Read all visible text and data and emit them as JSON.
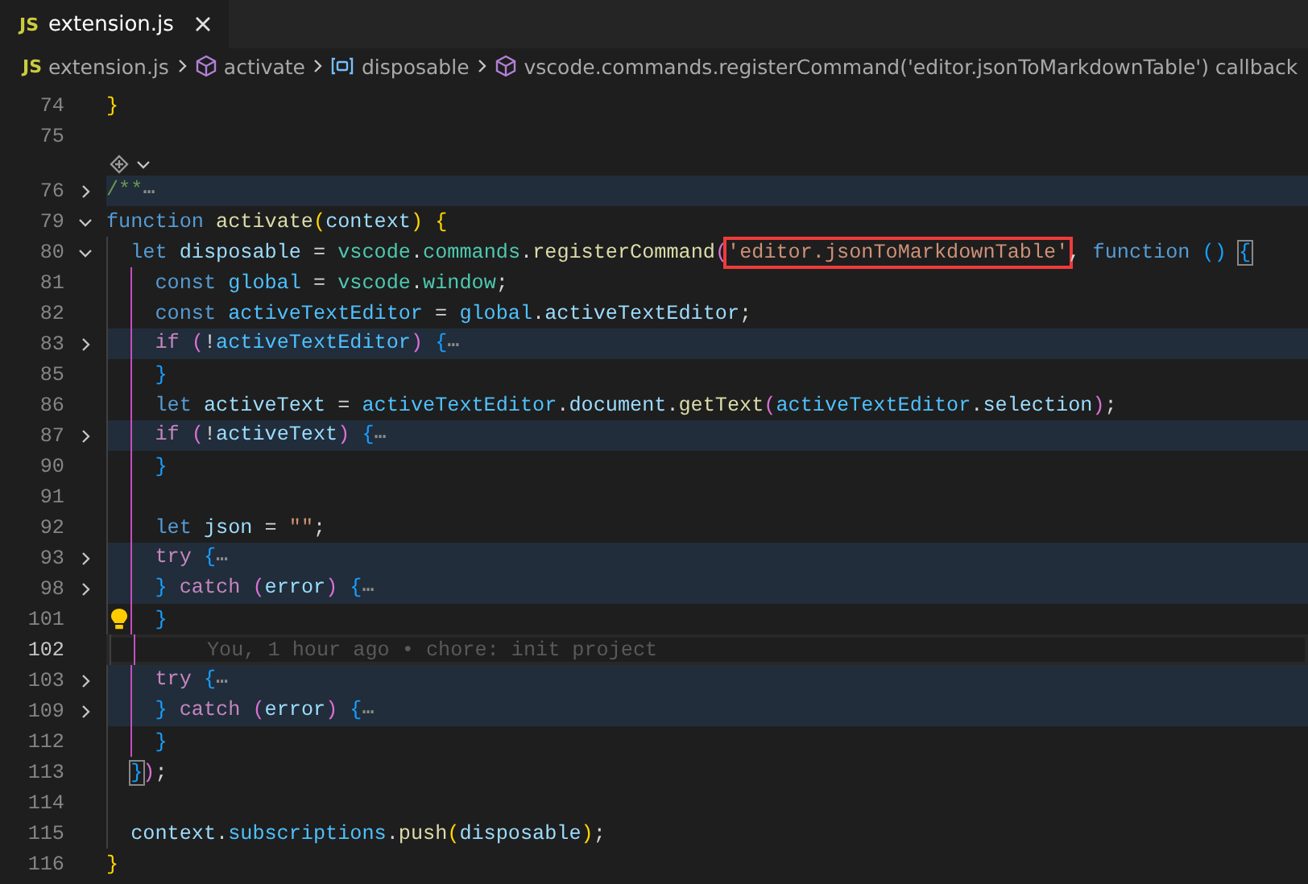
{
  "tab": {
    "icon_label": "JS",
    "title": "extension.js",
    "selected": true
  },
  "breadcrumbs": [
    {
      "kind": "file",
      "icon_label": "JS",
      "label": "extension.js"
    },
    {
      "kind": "method",
      "label": "activate"
    },
    {
      "kind": "variable",
      "label": "disposable"
    },
    {
      "kind": "method",
      "label": "vscode.commands.registerCommand('editor.jsonToMarkdownTable') callback"
    }
  ],
  "lines": [
    {
      "kind": "code",
      "number": "74",
      "tokens": [
        {
          "text": "}",
          "kind": "b1"
        }
      ]
    },
    {
      "kind": "code",
      "number": "75"
    },
    {
      "kind": "codelens"
    },
    {
      "kind": "code",
      "number": "76",
      "folded": true,
      "tokens": [
        {
          "text": "/**",
          "kind": "comment"
        },
        {
          "text": "⋯",
          "kind": "ellipsis"
        }
      ]
    },
    {
      "kind": "code",
      "number": "79",
      "folded": false,
      "tokens": [
        {
          "text": "function",
          "kind": "kw"
        },
        {
          "text": " activate",
          "kind": "fn"
        },
        {
          "text": "(",
          "kind": "b1"
        },
        {
          "text": "context",
          "kind": "var"
        },
        {
          "text": ")",
          "kind": "b1"
        },
        {
          "text": " {",
          "kind": "b1"
        }
      ],
      "children": [
        {
          "kind": "code",
          "number": "80",
          "folded": false,
          "tokens": [
            {
              "text": "let",
              "kind": "kw"
            },
            {
              "text": " disposable",
              "kind": "var"
            },
            {
              "text": " = ",
              "kind": "op"
            },
            {
              "text": "vscode",
              "kind": "cls"
            },
            {
              "text": ".",
              "kind": "op"
            },
            {
              "text": "commands",
              "kind": "cls"
            },
            {
              "text": ".",
              "kind": "op"
            },
            {
              "text": "registerCommand",
              "kind": "fn"
            },
            {
              "text": "(",
              "kind": "b2"
            },
            {
              "text": "'editor.jsonToMarkdownTable'",
              "kind": "str",
              "annotated": true
            },
            {
              "text": ", ",
              "kind": "op"
            },
            {
              "text": "function",
              "kind": "kw"
            },
            {
              "text": " () ",
              "kind": "b3"
            },
            {
              "text": "{",
              "kind": "b3",
              "bracket_match": true
            }
          ],
          "children": [
            {
              "kind": "code",
              "number": "81",
              "tokens": [
                {
                  "text": "const",
                  "kind": "kw"
                },
                {
                  "text": " global",
                  "kind": "const"
                },
                {
                  "text": " = ",
                  "kind": "op"
                },
                {
                  "text": "vscode",
                  "kind": "cls"
                },
                {
                  "text": ".",
                  "kind": "op"
                },
                {
                  "text": "window",
                  "kind": "cls"
                },
                {
                  "text": ";",
                  "kind": "op"
                }
              ]
            },
            {
              "kind": "code",
              "number": "82",
              "tokens": [
                {
                  "text": "const",
                  "kind": "kw"
                },
                {
                  "text": " activeTextEditor",
                  "kind": "const"
                },
                {
                  "text": " = ",
                  "kind": "op"
                },
                {
                  "text": "global",
                  "kind": "const"
                },
                {
                  "text": ".",
                  "kind": "op"
                },
                {
                  "text": "activeTextEditor",
                  "kind": "var"
                },
                {
                  "text": ";",
                  "kind": "op"
                }
              ]
            },
            {
              "kind": "code",
              "number": "83",
              "folded": true,
              "tokens": [
                {
                  "text": "if",
                  "kind": "ctl"
                },
                {
                  "text": " (",
                  "kind": "b2"
                },
                {
                  "text": "!",
                  "kind": "op"
                },
                {
                  "text": "activeTextEditor",
                  "kind": "const"
                },
                {
                  "text": ")",
                  "kind": "b2"
                },
                {
                  "text": " {",
                  "kind": "b3"
                },
                {
                  "text": "⋯",
                  "kind": "ellipsis"
                }
              ]
            },
            {
              "kind": "code",
              "number": "85",
              "tokens": [
                {
                  "text": "}",
                  "kind": "b3"
                }
              ]
            },
            {
              "kind": "code",
              "number": "86",
              "tokens": [
                {
                  "text": "let",
                  "kind": "kw"
                },
                {
                  "text": " activeText",
                  "kind": "var"
                },
                {
                  "text": " = ",
                  "kind": "op"
                },
                {
                  "text": "activeTextEditor",
                  "kind": "const"
                },
                {
                  "text": ".",
                  "kind": "op"
                },
                {
                  "text": "document",
                  "kind": "var"
                },
                {
                  "text": ".",
                  "kind": "op"
                },
                {
                  "text": "getText",
                  "kind": "fn"
                },
                {
                  "text": "(",
                  "kind": "b2"
                },
                {
                  "text": "activeTextEditor",
                  "kind": "const"
                },
                {
                  "text": ".",
                  "kind": "op"
                },
                {
                  "text": "selection",
                  "kind": "var"
                },
                {
                  "text": ")",
                  "kind": "b2"
                },
                {
                  "text": ";",
                  "kind": "op"
                }
              ]
            },
            {
              "kind": "code",
              "number": "87",
              "folded": true,
              "tokens": [
                {
                  "text": "if",
                  "kind": "ctl"
                },
                {
                  "text": " (",
                  "kind": "b2"
                },
                {
                  "text": "!",
                  "kind": "op"
                },
                {
                  "text": "activeText",
                  "kind": "var"
                },
                {
                  "text": ")",
                  "kind": "b2"
                },
                {
                  "text": " {",
                  "kind": "b3"
                },
                {
                  "text": "⋯",
                  "kind": "ellipsis"
                }
              ]
            },
            {
              "kind": "code",
              "number": "90",
              "tokens": [
                {
                  "text": "}",
                  "kind": "b3"
                }
              ]
            },
            {
              "kind": "code",
              "number": "91"
            },
            {
              "kind": "code",
              "number": "92",
              "tokens": [
                {
                  "text": "let",
                  "kind": "kw"
                },
                {
                  "text": " json",
                  "kind": "var"
                },
                {
                  "text": " = ",
                  "kind": "op"
                },
                {
                  "text": "\"\"",
                  "kind": "str"
                },
                {
                  "text": ";",
                  "kind": "op"
                }
              ]
            },
            {
              "kind": "code",
              "number": "93",
              "folded": true,
              "tokens": [
                {
                  "text": "try",
                  "kind": "ctl"
                },
                {
                  "text": " {",
                  "kind": "b3"
                },
                {
                  "text": "⋯",
                  "kind": "ellipsis"
                }
              ]
            },
            {
              "kind": "code",
              "number": "98",
              "folded": true,
              "tokens": [
                {
                  "text": "}",
                  "kind": "b3"
                },
                {
                  "text": " catch",
                  "kind": "ctl"
                },
                {
                  "text": " (",
                  "kind": "b2"
                },
                {
                  "text": "error",
                  "kind": "var"
                },
                {
                  "text": ")",
                  "kind": "b2"
                },
                {
                  "text": " {",
                  "kind": "b3"
                },
                {
                  "text": "⋯",
                  "kind": "ellipsis"
                }
              ]
            },
            {
              "kind": "code",
              "number": "101",
              "lightbulb": true,
              "tokens": [
                {
                  "text": "}",
                  "kind": "b3"
                }
              ]
            },
            {
              "kind": "code",
              "number": "102",
              "current": true,
              "blame": "You, 1 hour ago • chore: init project"
            },
            {
              "kind": "code",
              "number": "103",
              "folded": true,
              "tokens": [
                {
                  "text": "try",
                  "kind": "ctl"
                },
                {
                  "text": " {",
                  "kind": "b3"
                },
                {
                  "text": "⋯",
                  "kind": "ellipsis"
                }
              ]
            },
            {
              "kind": "code",
              "number": "109",
              "folded": true,
              "tokens": [
                {
                  "text": "}",
                  "kind": "b3"
                },
                {
                  "text": " catch",
                  "kind": "ctl"
                },
                {
                  "text": " (",
                  "kind": "b2"
                },
                {
                  "text": "error",
                  "kind": "var"
                },
                {
                  "text": ")",
                  "kind": "b2"
                },
                {
                  "text": " {",
                  "kind": "b3"
                },
                {
                  "text": "⋯",
                  "kind": "ellipsis"
                }
              ]
            },
            {
              "kind": "code",
              "number": "112",
              "tokens": [
                {
                  "text": "}",
                  "kind": "b3"
                }
              ]
            }
          ]
        },
        {
          "kind": "code",
          "number": "113",
          "tokens": [
            {
              "text": "}",
              "kind": "b3",
              "bracket_match": true
            },
            {
              "text": ")",
              "kind": "b2"
            },
            {
              "text": ";",
              "kind": "op"
            }
          ]
        },
        {
          "kind": "code",
          "number": "114"
        },
        {
          "kind": "code",
          "number": "115",
          "tokens": [
            {
              "text": "context",
              "kind": "var"
            },
            {
              "text": ".",
              "kind": "op"
            },
            {
              "text": "subscriptions",
              "kind": "const"
            },
            {
              "text": ".",
              "kind": "op"
            },
            {
              "text": "push",
              "kind": "fn"
            },
            {
              "text": "(",
              "kind": "b1"
            },
            {
              "text": "disposable",
              "kind": "var"
            },
            {
              "text": ")",
              "kind": "b1"
            },
            {
              "text": ";",
              "kind": "op"
            }
          ]
        }
      ]
    },
    {
      "kind": "code",
      "number": "116",
      "tokens": [
        {
          "text": "}",
          "kind": "b1"
        }
      ]
    }
  ]
}
